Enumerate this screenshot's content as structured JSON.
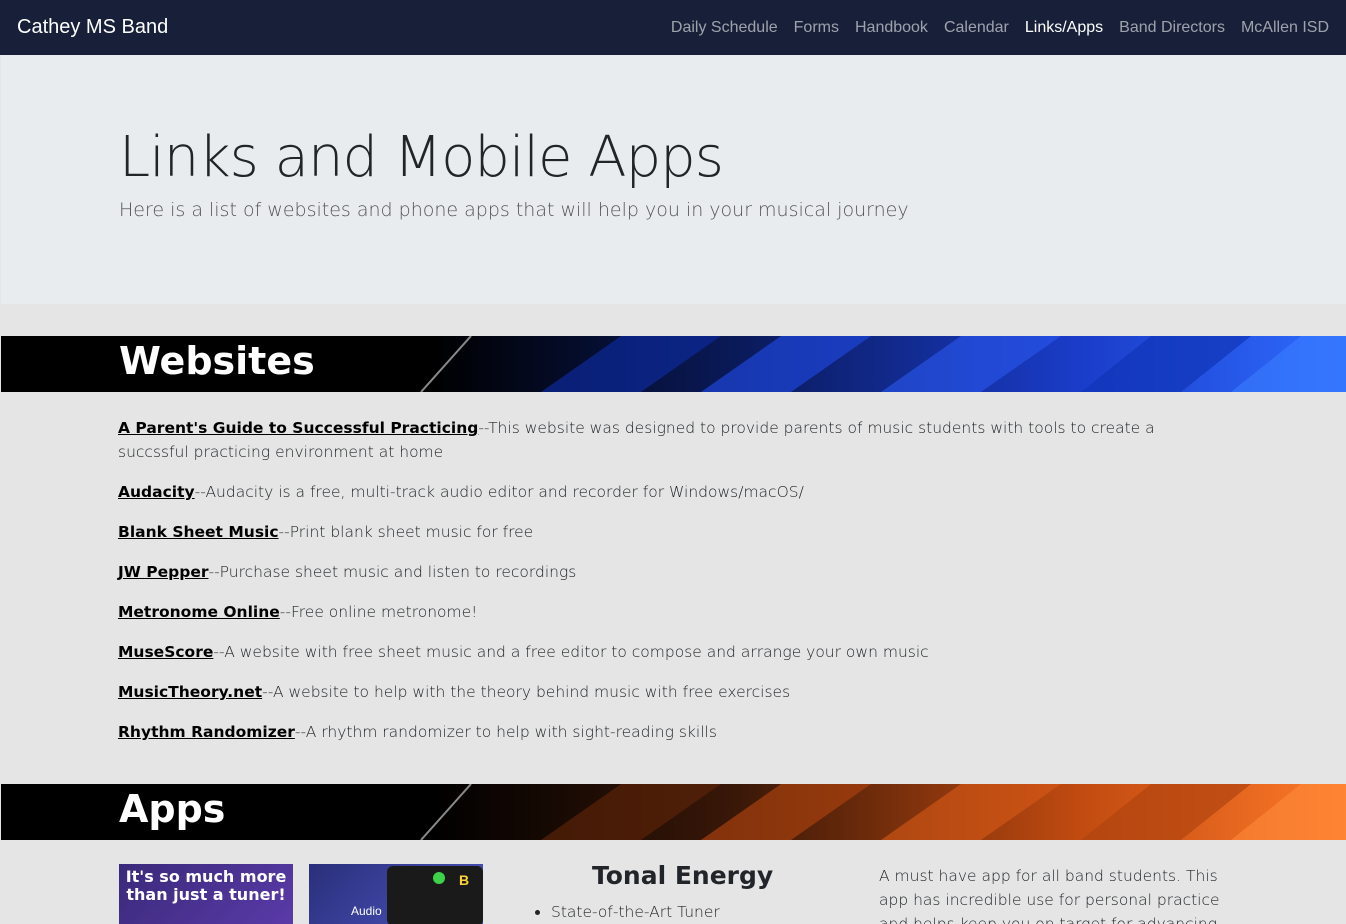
{
  "navbar": {
    "brand": "Cathey MS Band",
    "links": [
      "Daily Schedule",
      "Forms",
      "Handbook",
      "Calendar",
      "Links/Apps",
      "Band Directors",
      "McAllen ISD"
    ],
    "active": "Links/Apps"
  },
  "jumbotron": {
    "title": "Links and Mobile Apps",
    "subtitle": "Here is a list of websites and phone apps that will help you in your musical journey"
  },
  "websites": {
    "heading": "Websites",
    "items": [
      {
        "link": "A Parent's Guide to Successful Practicing",
        "desc": "--This website was designed to provide parents of music students with tools to create a succssful practicing environment at home"
      },
      {
        "link": "Audacity",
        "desc": "--Audacity is a free, multi-track audio editor and recorder for Windows/macOS/"
      },
      {
        "link": "Blank Sheet Music",
        "desc": "--Print blank sheet music for free"
      },
      {
        "link": "JW Pepper",
        "desc": "--Purchase sheet music and listen to recordings"
      },
      {
        "link": "Metronome Online",
        "desc": "--Free online metronome!"
      },
      {
        "link": "MuseScore",
        "desc": "--A website with free sheet music and a free editor to compose and arrange your own music"
      },
      {
        "link": "MusicTheory.net",
        "desc": "--A website to help with the theory behind music with free exercises"
      },
      {
        "link": "Rhythm Randomizer",
        "desc": "--A rhythm randomizer to help with sight-reading skills"
      }
    ]
  },
  "apps": {
    "heading": "Apps",
    "image1_text": "It's so much more than just a tuner!",
    "image2_label": "Audio",
    "image2_badge": "B",
    "app_name": "Tonal Energy",
    "features": [
      "State-of-the-Art Tuner"
    ],
    "description": "A must have app for all band students. This app has incredible use for personal practice and helps keep you on target for advancing on your"
  },
  "colors": {
    "navbar_bg": "#172038",
    "jumbotron_bg": "#e9ecef",
    "page_bg": "#e5e5e5",
    "banner_web_accent": "#1f4fd8",
    "banner_apps_accent": "#e0601a"
  }
}
